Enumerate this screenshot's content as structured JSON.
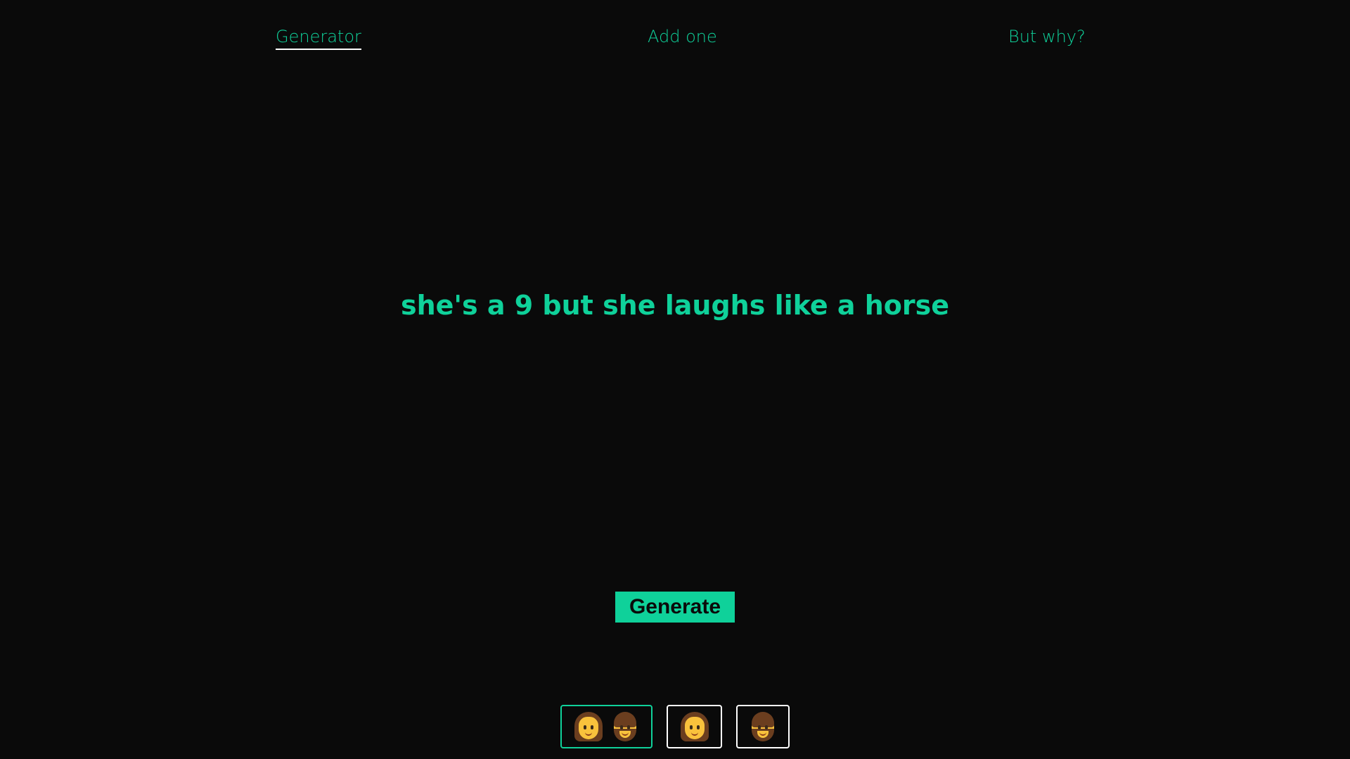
{
  "nav": {
    "generator": "Generator",
    "add_one": "Add one",
    "but_why": "But why?"
  },
  "headline": "she's a 9 but she laughs like a horse",
  "generate_label": "Generate",
  "filters": [
    {
      "icons": [
        "woman-emoji-icon",
        "man-emoji-icon"
      ],
      "selected": true
    },
    {
      "icons": [
        "woman-emoji-icon"
      ],
      "selected": false
    },
    {
      "icons": [
        "man-emoji-icon"
      ],
      "selected": false
    }
  ],
  "colors": {
    "background": "#0a0a0a",
    "accent": "#0fd19a",
    "underline": "#ffffff"
  }
}
